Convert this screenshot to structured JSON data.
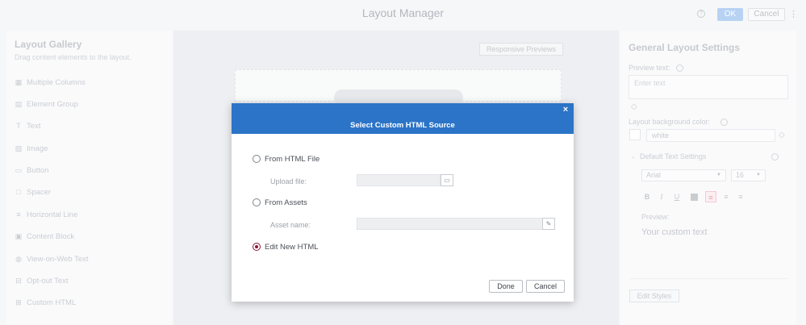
{
  "app": {
    "title": "Layout Manager",
    "help_glyph": "?",
    "ok_label": "OK",
    "cancel_label": "Cancel",
    "more_glyph": "⋮"
  },
  "gallery": {
    "title": "Layout Gallery",
    "subtitle": "Drag content elements to the layout.",
    "items": [
      {
        "label": "Multiple Columns",
        "icon": "columns-icon",
        "glyph": "▦"
      },
      {
        "label": "Element Group",
        "icon": "element-group-icon",
        "glyph": "▤"
      },
      {
        "label": "Text",
        "icon": "text-icon",
        "glyph": "T"
      },
      {
        "label": "Image",
        "icon": "image-icon",
        "glyph": "▨"
      },
      {
        "label": "Button",
        "icon": "button-icon",
        "glyph": "▭"
      },
      {
        "label": "Spacer",
        "icon": "spacer-icon",
        "glyph": "□"
      },
      {
        "label": "Horizontal Line",
        "icon": "horizontal-line-icon",
        "glyph": "≡"
      },
      {
        "label": "Content Block",
        "icon": "content-block-icon",
        "glyph": "▣"
      },
      {
        "label": "View-on-Web Text",
        "icon": "globe-icon",
        "glyph": "◍"
      },
      {
        "label": "Opt-out Text",
        "icon": "opt-out-icon",
        "glyph": "⊟"
      },
      {
        "label": "Custom HTML",
        "icon": "custom-html-icon",
        "glyph": "⊞"
      }
    ]
  },
  "canvas": {
    "responsive_label": "Responsive Previews"
  },
  "settings": {
    "title": "General Layout Settings",
    "preview_text_label": "Preview text:",
    "preview_text_placeholder": "Enter text",
    "bg_color_label": "Layout background color:",
    "bg_color_value": "white",
    "default_text_label": "Default Text Settings",
    "font_family": "Arial",
    "font_size": "16",
    "bold": "B",
    "italic": "I",
    "underline": "U",
    "preview_label": "Preview:",
    "preview_sample": "Your custom text",
    "edit_styles_label": "Edit Styles"
  },
  "modal": {
    "title": "Select Custom HTML Source",
    "close_glyph": "×",
    "options": [
      {
        "label": "From HTML File",
        "selected": false
      },
      {
        "label": "From Assets",
        "selected": false
      },
      {
        "label": "Edit New HTML",
        "selected": true
      }
    ],
    "upload_label": "Upload file:",
    "asset_label": "Asset name:",
    "done_label": "Done",
    "cancel_label": "Cancel"
  },
  "colors": {
    "header_blue": "#2b74c7",
    "selected_radio": "#8a1538",
    "ok_button": "#9fc3ef"
  }
}
